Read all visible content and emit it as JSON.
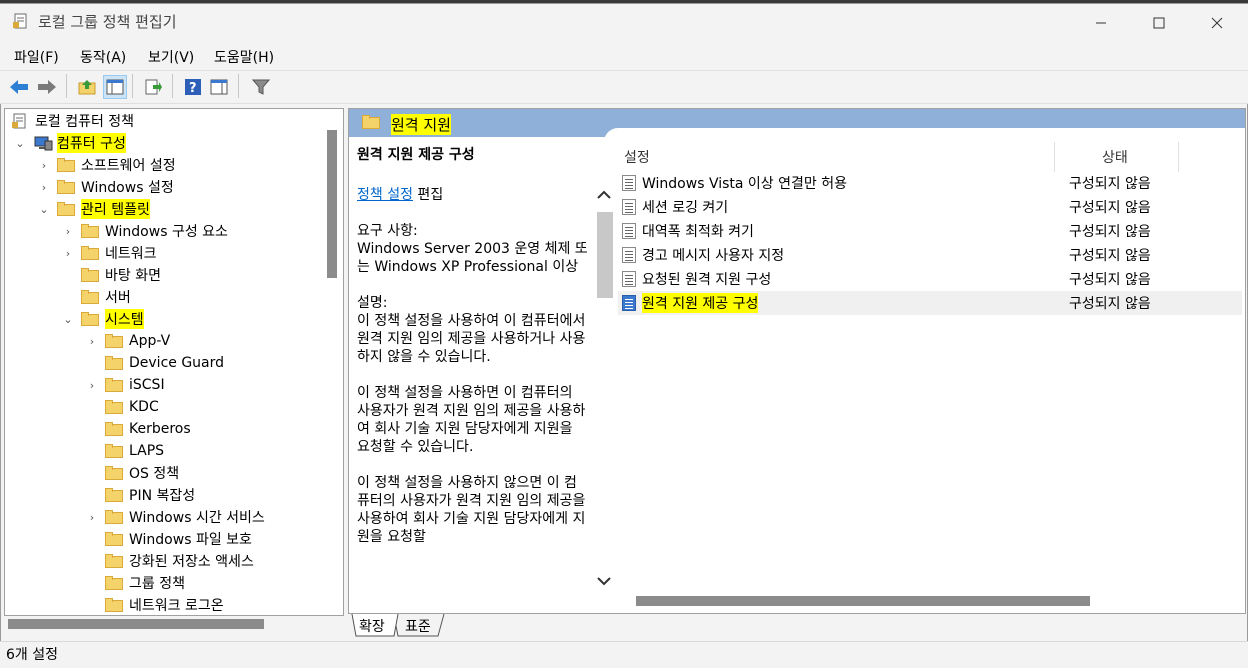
{
  "window": {
    "title": "로컬 그룹 정책 편집기"
  },
  "menubar": {
    "items": [
      "파일(F)",
      "동작(A)",
      "보기(V)",
      "도움말(H)"
    ]
  },
  "tree": {
    "root": "로컬 컴퓨터 정책",
    "items": [
      {
        "label": "컴퓨터 구성",
        "level": 1,
        "twisty": "⌄",
        "highlight": true
      },
      {
        "label": "소프트웨어 설정",
        "level": 2,
        "twisty": "›"
      },
      {
        "label": "Windows 설정",
        "level": 2,
        "twisty": "›"
      },
      {
        "label": "관리 템플릿",
        "level": 2,
        "twisty": "⌄",
        "highlight": true
      },
      {
        "label": "Windows 구성 요소",
        "level": 3,
        "twisty": "›"
      },
      {
        "label": "네트워크",
        "level": 3,
        "twisty": "›"
      },
      {
        "label": "바탕 화면",
        "level": 3,
        "twisty": ""
      },
      {
        "label": "서버",
        "level": 3,
        "twisty": ""
      },
      {
        "label": "시스템",
        "level": 3,
        "twisty": "⌄",
        "highlight": true
      },
      {
        "label": "App-V",
        "level": 4,
        "twisty": "›"
      },
      {
        "label": "Device Guard",
        "level": 4,
        "twisty": ""
      },
      {
        "label": "iSCSI",
        "level": 4,
        "twisty": "›"
      },
      {
        "label": "KDC",
        "level": 4,
        "twisty": ""
      },
      {
        "label": "Kerberos",
        "level": 4,
        "twisty": ""
      },
      {
        "label": "LAPS",
        "level": 4,
        "twisty": ""
      },
      {
        "label": "OS 정책",
        "level": 4,
        "twisty": ""
      },
      {
        "label": "PIN 복잡성",
        "level": 4,
        "twisty": ""
      },
      {
        "label": "Windows 시간 서비스",
        "level": 4,
        "twisty": "›"
      },
      {
        "label": "Windows 파일 보호",
        "level": 4,
        "twisty": ""
      },
      {
        "label": "강화된 저장소 액세스",
        "level": 4,
        "twisty": ""
      },
      {
        "label": "그룹 정책",
        "level": 4,
        "twisty": ""
      },
      {
        "label": "네트워크 로그온",
        "level": 4,
        "twisty": ""
      }
    ]
  },
  "header": {
    "title": "원격 지원"
  },
  "description": {
    "title": "원격 지원 제공 구성",
    "link": "정책 설정",
    "edit": " 편집",
    "req_label": "요구 사항:",
    "req_text": "Windows Server 2003 운영 체제 또는 Windows XP Professional 이상",
    "desc_label": "설명:",
    "p1": "이 정책 설정을 사용하여 이 컴퓨터에서 원격 지원 임의 제공을 사용하거나 사용하지 않을 수 있습니다.",
    "p2": "이 정책 설정을 사용하면 이 컴퓨터의 사용자가 원격 지원 임의 제공을 사용하여 회사 기술 지원 담당자에게 지원을 요청할 수 있습니다.",
    "p3": "이 정책 설정을 사용하지 않으면 이 컴퓨터의 사용자가 원격 지원 임의 제공을 사용하여 회사 기술 지원 담당자에게 지원을 요청할"
  },
  "list": {
    "col_settings": "설정",
    "col_state": "상태",
    "rows": [
      {
        "name": "Windows Vista 이상 연결만 허용",
        "state": "구성되지 않음"
      },
      {
        "name": "세션 로깅 켜기",
        "state": "구성되지 않음"
      },
      {
        "name": "대역폭 최적화 켜기",
        "state": "구성되지 않음"
      },
      {
        "name": "경고 메시지 사용자 지정",
        "state": "구성되지 않음"
      },
      {
        "name": "요청된 원격 지원 구성",
        "state": "구성되지 않음"
      },
      {
        "name": "원격 지원 제공 구성",
        "state": "구성되지 않음",
        "selected": true
      }
    ]
  },
  "tabs": {
    "extended": "확장",
    "standard": "표준"
  },
  "status": {
    "text": "6개 설정"
  },
  "colors": {
    "header_band": "#8fb0d8",
    "highlight": "#ffff00",
    "link": "#0066cc"
  }
}
